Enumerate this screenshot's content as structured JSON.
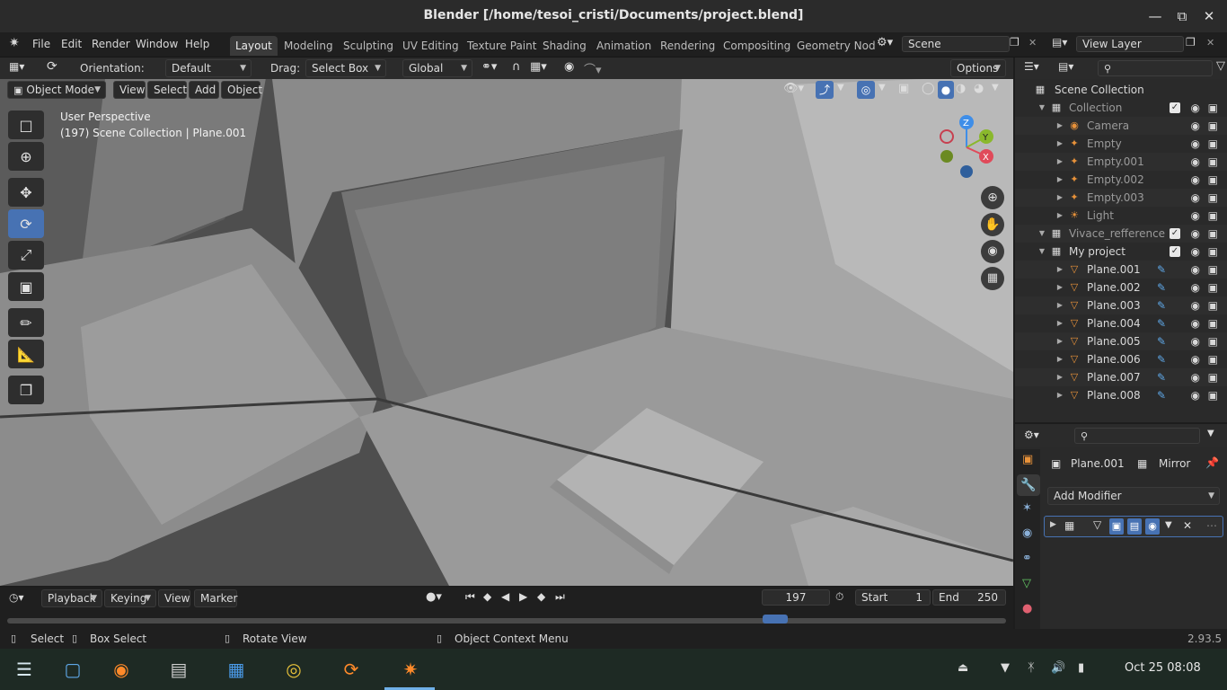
{
  "window": {
    "title": "Blender [/home/tesoi_cristi/Documents/project.blend]",
    "minimize_icon": "minimize-icon",
    "maximize_icon": "restore-icon",
    "close_icon": "close-icon"
  },
  "menubar": {
    "items": [
      "File",
      "Edit",
      "Render",
      "Window",
      "Help"
    ]
  },
  "workspaces": {
    "tabs": [
      "Layout",
      "Modeling",
      "Sculpting",
      "UV Editing",
      "Texture Paint",
      "Shading",
      "Animation",
      "Rendering",
      "Compositing",
      "Geometry Nod"
    ],
    "active": "Layout"
  },
  "scene": {
    "value": "Scene"
  },
  "view_layer": {
    "value": "View Layer"
  },
  "tool_header": {
    "orientation_label": "Orientation:",
    "orientation_value": "Default",
    "drag_label": "Drag:",
    "drag_value": "Select Box",
    "transform_value": "Global",
    "options_label": "Options"
  },
  "viewport_header": {
    "mode": "Object Mode",
    "menus": [
      "View",
      "Select",
      "Add",
      "Object"
    ]
  },
  "viewport": {
    "perspective_label": "User Perspective",
    "info_label": "(197) Scene Collection | Plane.001",
    "gizmo": {
      "z": "Z",
      "y": "Y",
      "x": "X"
    }
  },
  "outliner": {
    "root": "Scene Collection",
    "rows": [
      {
        "label": "Collection",
        "indent": 1,
        "type": "collection",
        "dim": true
      },
      {
        "label": "Camera",
        "indent": 2,
        "type": "camera",
        "dim": true
      },
      {
        "label": "Empty",
        "indent": 2,
        "type": "empty",
        "dim": true
      },
      {
        "label": "Empty.001",
        "indent": 2,
        "type": "empty",
        "dim": true
      },
      {
        "label": "Empty.002",
        "indent": 2,
        "type": "empty",
        "dim": true
      },
      {
        "label": "Empty.003",
        "indent": 2,
        "type": "empty",
        "dim": true
      },
      {
        "label": "Light",
        "indent": 2,
        "type": "light",
        "dim": true
      },
      {
        "label": "Vivace_refference",
        "indent": 1,
        "type": "collection",
        "dim": true
      },
      {
        "label": "My project",
        "indent": 1,
        "type": "collection",
        "dim": false
      },
      {
        "label": "Plane.001",
        "indent": 2,
        "type": "mesh",
        "dim": false
      },
      {
        "label": "Plane.002",
        "indent": 2,
        "type": "mesh",
        "dim": false
      },
      {
        "label": "Plane.003",
        "indent": 2,
        "type": "mesh",
        "dim": false
      },
      {
        "label": "Plane.004",
        "indent": 2,
        "type": "mesh",
        "dim": false
      },
      {
        "label": "Plane.005",
        "indent": 2,
        "type": "mesh",
        "dim": false
      },
      {
        "label": "Plane.006",
        "indent": 2,
        "type": "mesh",
        "dim": false
      },
      {
        "label": "Plane.007",
        "indent": 2,
        "type": "mesh",
        "dim": false
      },
      {
        "label": "Plane.008",
        "indent": 2,
        "type": "mesh",
        "dim": false
      }
    ]
  },
  "properties": {
    "object_name": "Plane.001",
    "modifier_name": "Mirror",
    "add_modifier_label": "Add Modifier"
  },
  "timeline": {
    "menus": [
      "Playback",
      "Keying",
      "View",
      "Marker"
    ],
    "current_frame": "197",
    "start_label": "Start",
    "start_value": "1",
    "end_label": "End",
    "end_value": "250"
  },
  "statusbar": {
    "select": "Select",
    "box_select": "Box Select",
    "rotate_view": "Rotate View",
    "context_menu": "Object Context Menu",
    "version": "2.93.5"
  },
  "taskbar": {
    "datetime": "Oct 25  08:08"
  },
  "colors": {
    "accent": "#4772b3",
    "mesh_orange": "#e8923a",
    "gizmo_x": "#e04a5a",
    "gizmo_y": "#8ab82c",
    "gizmo_z": "#3f8ee8"
  }
}
